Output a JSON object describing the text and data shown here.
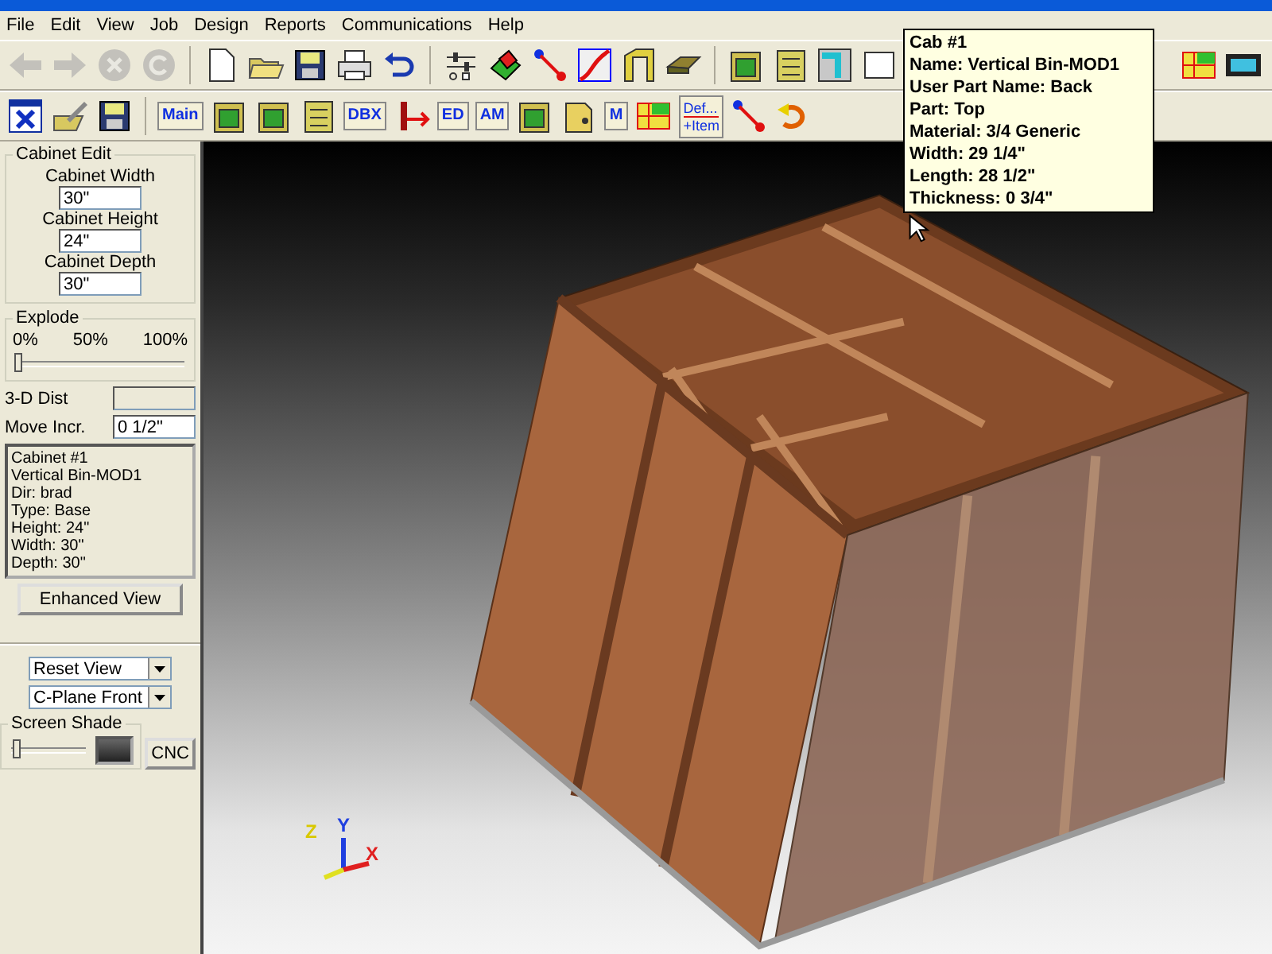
{
  "menu": [
    "File",
    "Edit",
    "View",
    "Job",
    "Design",
    "Reports",
    "Communications",
    "Help"
  ],
  "toolbar_1": [
    {
      "kind": "arrow-left",
      "disabled": true
    },
    {
      "kind": "arrow-right",
      "disabled": true
    },
    {
      "kind": "stop",
      "disabled": true
    },
    {
      "kind": "refresh",
      "disabled": true
    },
    {
      "kind": "sep",
      "disabled": false
    },
    {
      "kind": "new",
      "disabled": false
    },
    {
      "kind": "open",
      "disabled": false
    },
    {
      "kind": "save",
      "disabled": false
    },
    {
      "kind": "print",
      "disabled": false
    },
    {
      "kind": "undo",
      "disabled": false
    },
    {
      "kind": "sep",
      "disabled": false
    },
    {
      "kind": "sliders",
      "disabled": false
    },
    {
      "kind": "part",
      "disabled": false
    },
    {
      "kind": "node",
      "disabled": false
    },
    {
      "kind": "profile",
      "disabled": false
    },
    {
      "kind": "frame",
      "disabled": false
    },
    {
      "kind": "tray",
      "disabled": false
    },
    {
      "kind": "sep",
      "disabled": false
    },
    {
      "kind": "cabinet",
      "disabled": false
    },
    {
      "kind": "drawers",
      "disabled": false
    },
    {
      "kind": "corner",
      "disabled": false
    },
    {
      "kind": "gap",
      "disabled": false
    },
    {
      "kind": "grid",
      "disabled": false
    },
    {
      "kind": "film",
      "disabled": false
    }
  ],
  "toolbar_2": [
    {
      "kind": "window"
    },
    {
      "kind": "edit"
    },
    {
      "kind": "save"
    },
    {
      "kind": "sep"
    },
    {
      "kind": "text",
      "label": "Main"
    },
    {
      "kind": "cabinet"
    },
    {
      "kind": "cabinet"
    },
    {
      "kind": "drawers"
    },
    {
      "kind": "text",
      "label": "DBX"
    },
    {
      "kind": "width"
    },
    {
      "kind": "text",
      "label": "ED"
    },
    {
      "kind": "text",
      "label": "AM"
    },
    {
      "kind": "cabinet"
    },
    {
      "kind": "door"
    },
    {
      "kind": "text",
      "label": "M"
    },
    {
      "kind": "grid"
    },
    {
      "kind": "text2",
      "label": "Def...",
      "label2": "+Item"
    },
    {
      "kind": "node"
    },
    {
      "kind": "rotate"
    }
  ],
  "cabinet_edit": {
    "title": "Cabinet Edit",
    "fields": [
      {
        "label": "Cabinet Width",
        "value": "30\""
      },
      {
        "label": "Cabinet Height",
        "value": "24\""
      },
      {
        "label": "Cabinet Depth",
        "value": "30\""
      }
    ]
  },
  "explode": {
    "title": "Explode",
    "ticks": [
      "0%",
      "50%",
      "100%"
    ],
    "level": 0
  },
  "dist": {
    "label": "3-D Dist"
  },
  "move_incr": {
    "label": "Move Incr.",
    "value": "0 1/2\""
  },
  "info_lines": [
    "Cabinet #1",
    "Vertical Bin-MOD1",
    "Dir: brad",
    "Type: Base",
    "Height: 24\"",
    "Width: 30\"",
    "Depth: 30\""
  ],
  "enhanced_button": "Enhanced View",
  "view_select": "Reset View",
  "cplane_select": "C-Plane Front",
  "screen_shade": {
    "title": "Screen Shade",
    "level": 0.05
  },
  "cnc_button": "CNC",
  "tooltip": [
    "Cab #1",
    "Name: Vertical Bin-MOD1",
    "User Part Name: Back",
    "Part: Top",
    "Material: 3/4 Generic",
    "Width: 29 1/4\"",
    "Length: 28 1/2\"",
    "Thickness: 0 3/4\""
  ],
  "axes": [
    "Z",
    "Y",
    "X"
  ]
}
